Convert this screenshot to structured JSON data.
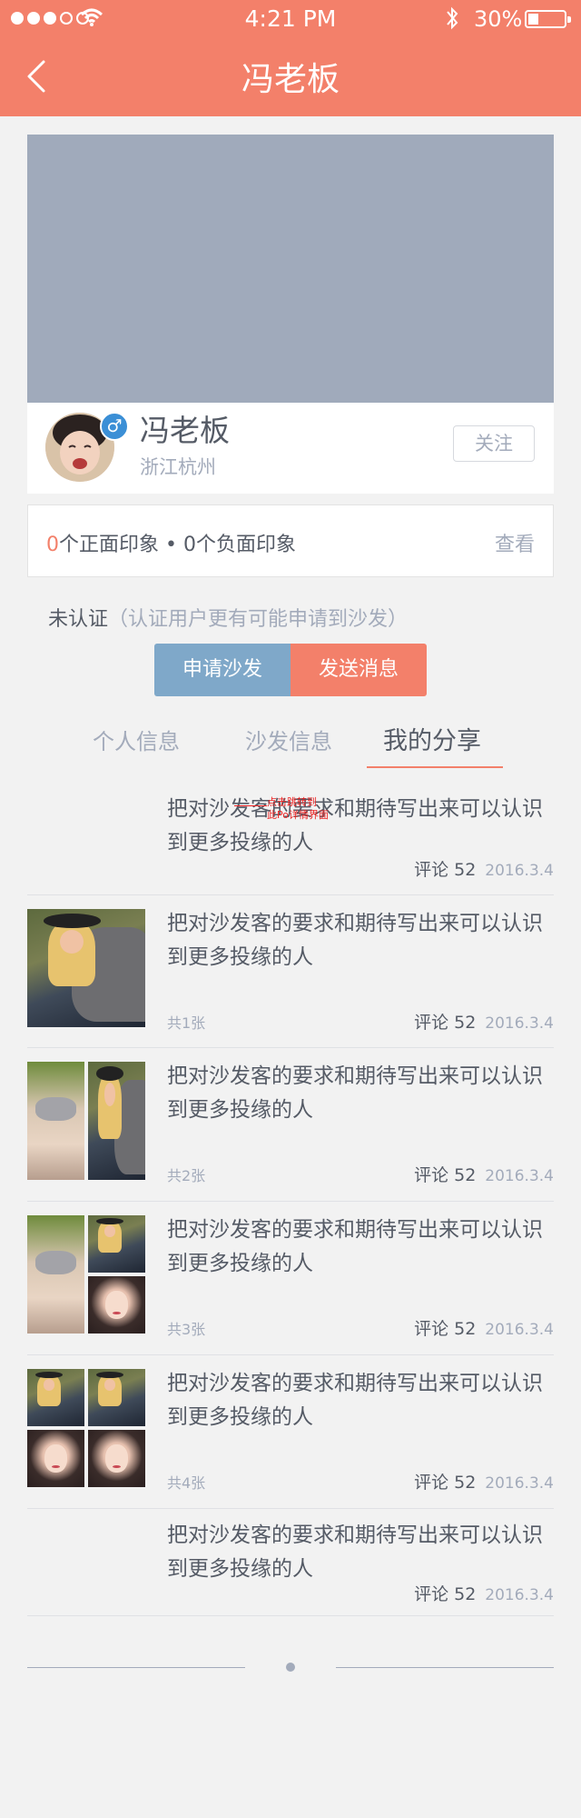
{
  "status_bar": {
    "time": "4:21 PM",
    "battery_percent": "30%",
    "battery_level": 0.3,
    "signal_dots_filled": 3,
    "signal_dots_total": 5
  },
  "nav": {
    "title": "冯老板"
  },
  "profile": {
    "name": "冯老板",
    "location": "浙江杭州",
    "gender_symbol": "♂",
    "follow_label": "关注"
  },
  "impressions": {
    "positive_count": "0",
    "positive_text": "个正面印象",
    "separator": " • ",
    "negative_count": "0",
    "negative_text": "个负面印象",
    "view_label": "查看"
  },
  "verify": {
    "status": "未认证",
    "note": "（认证用户更有可能申请到沙发）"
  },
  "actions": {
    "apply_label": "申请沙发",
    "message_label": "发送消息"
  },
  "tabs": [
    {
      "label": "个人信息",
      "active": false
    },
    {
      "label": "沙发信息",
      "active": false
    },
    {
      "label": "我的分享",
      "active": true
    }
  ],
  "annotation": {
    "line1": "点击跳转到",
    "line2": "此Po详情界面"
  },
  "posts": [
    {
      "text": "把对沙发客的要求和期待写出来可以认识到更多投缘的人",
      "comments": "评论 52",
      "date": "2016.3.4",
      "photo_count": "",
      "photos": 0
    },
    {
      "text": "把对沙发客的要求和期待写出来可以认识到更多投缘的人",
      "comments": "评论 52",
      "date": "2016.3.4",
      "photo_count": "共1张",
      "photos": 1
    },
    {
      "text": "把对沙发客的要求和期待写出来可以认识到更多投缘的人",
      "comments": "评论 52",
      "date": "2016.3.4",
      "photo_count": "共2张",
      "photos": 2
    },
    {
      "text": "把对沙发客的要求和期待写出来可以认识到更多投缘的人",
      "comments": "评论 52",
      "date": "2016.3.4",
      "photo_count": "共3张",
      "photos": 3
    },
    {
      "text": "把对沙发客的要求和期待写出来可以认识到更多投缘的人",
      "comments": "评论 52",
      "date": "2016.3.4",
      "photo_count": "共4张",
      "photos": 4
    },
    {
      "text": "把对沙发客的要求和期待写出来可以认识到更多投缘的人",
      "comments": "评论 52",
      "date": "2016.3.4",
      "photo_count": "",
      "photos": 0
    }
  ],
  "colors": {
    "accent": "#f3806a",
    "secondary_button": "#7fa8c9",
    "text_primary": "#555b66",
    "text_muted": "#a3abbb",
    "cover": "#a0aabb",
    "background": "#f2f2f2"
  },
  "icons": {
    "back": "chevron-left-icon",
    "wifi": "wifi-icon",
    "bluetooth": "bluetooth-icon",
    "battery": "battery-icon",
    "gender": "male-icon"
  }
}
